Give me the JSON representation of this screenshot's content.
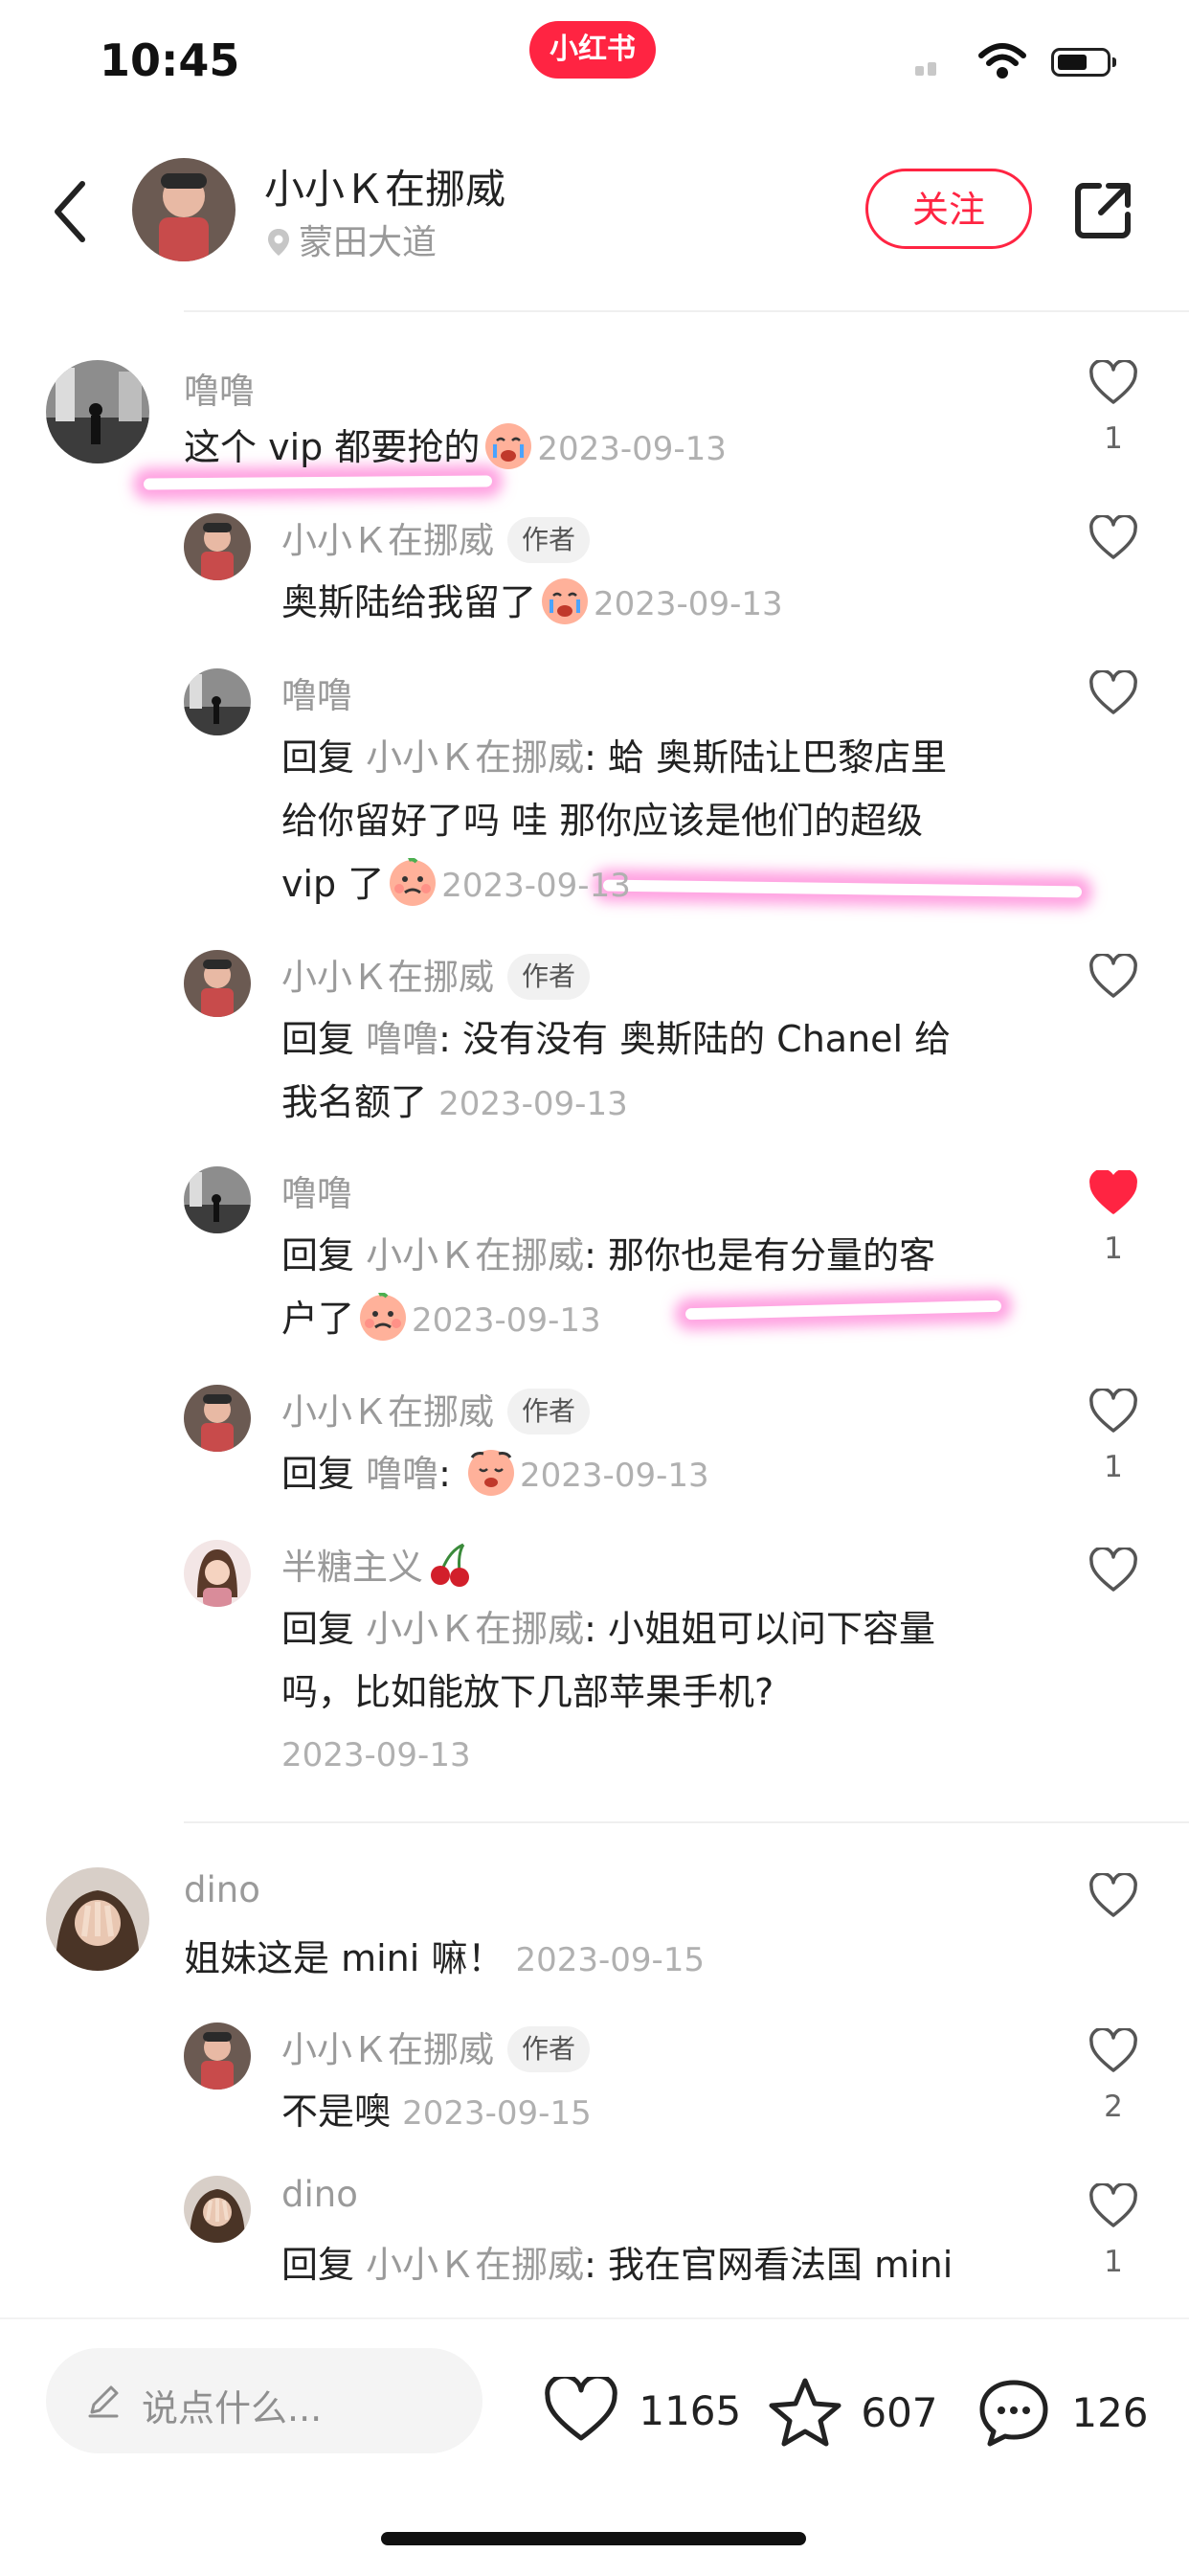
{
  "status_bar": {
    "time": "10:45",
    "app_logo": "小红书"
  },
  "header": {
    "author_name": "小小Ｋ在挪威",
    "location": "蒙田大道",
    "follow_label": "关注"
  },
  "icons": {
    "back": "chevron-left-icon",
    "share": "share-icon",
    "like": "heart-icon",
    "collect": "star-icon",
    "comment": "comment-bubble-icon",
    "edit": "pencil-icon",
    "location": "location-pin-icon"
  },
  "colors": {
    "brand": "#ff2442",
    "highlight": "#ff56c8",
    "muted_text": "#9a9a9a",
    "date_text": "#b0b0b0"
  },
  "comments": [
    {
      "user": "噜噜",
      "text": "这个 vip 都要抢的",
      "date": "2023-09-13",
      "likes": "1",
      "replies": [
        {
          "user": "小小Ｋ在挪威",
          "badge": "作者",
          "text": "奥斯陆给我留了",
          "date": "2023-09-13",
          "likes": ""
        },
        {
          "user": "噜噜",
          "reply_prefix": "回复",
          "reply_to": "小小Ｋ在挪威",
          "line1": ": 蛤 奥斯陆让巴黎店里",
          "line2": "给你留好了吗 哇 那你应该是他们的超级",
          "line3": "vip 了",
          "date": "2023-09-13",
          "likes": ""
        },
        {
          "user": "小小Ｋ在挪威",
          "badge": "作者",
          "reply_prefix": "回复",
          "reply_to": "噜噜",
          "line1": ": 没有没有 奥斯陆的 Chanel 给",
          "line2": "我名额了",
          "date": "2023-09-13",
          "likes": ""
        },
        {
          "user": "噜噜",
          "reply_prefix": "回复",
          "reply_to": "小小Ｋ在挪威",
          "line1": ": 那你也是有分量的客",
          "line2": "户了",
          "date": "2023-09-13",
          "likes": "1",
          "liked": true
        },
        {
          "user": "小小Ｋ在挪威",
          "badge": "作者",
          "reply_prefix": "回复",
          "reply_to": "噜噜",
          "line1": ":",
          "date": "2023-09-13",
          "likes": "1"
        },
        {
          "user": "半糖主义",
          "reply_prefix": "回复",
          "reply_to": "小小Ｋ在挪威",
          "line1": ": 小姐姐可以问下容量",
          "line2": "吗，比如能放下几部苹果手机?",
          "date": "2023-09-13",
          "likes": ""
        }
      ]
    },
    {
      "user": "dino",
      "text": "姐妹这是 mini 嘛！",
      "date": "2023-09-15",
      "likes": "",
      "replies": [
        {
          "user": "小小Ｋ在挪威",
          "badge": "作者",
          "text": "不是噢",
          "date": "2023-09-15",
          "likes": "2"
        },
        {
          "user": "dino",
          "reply_prefix": "回复",
          "reply_to": "小小Ｋ在挪威",
          "line1": ": 我在官网看法国 mini",
          "likes": "1"
        }
      ]
    }
  ],
  "bottom_bar": {
    "input_placeholder": "说点什么...",
    "likes_count": "1165",
    "collect_count": "607",
    "comment_count": "126"
  }
}
